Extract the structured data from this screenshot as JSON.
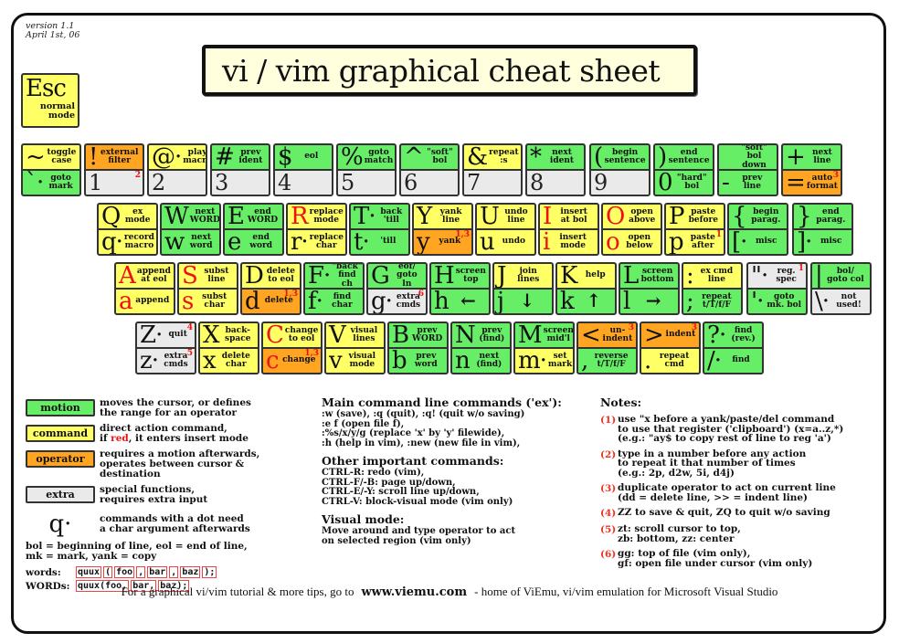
{
  "version": {
    "line1": "version 1.1",
    "line2": "April 1st, 06"
  },
  "title": "vi / vim graphical cheat sheet",
  "colors": {
    "motion": "#66ee66",
    "command": "#ffff66",
    "operator": "#ffa522",
    "extra": "#eaeaea",
    "red": "#ee1111"
  },
  "esc": {
    "glyph": "Esc",
    "desc": "normal\nmode",
    "type": "command"
  },
  "rows": [
    {
      "name": "number-row",
      "keys": [
        {
          "id": "tilde",
          "top": {
            "glyph": "~",
            "desc": "toggle\ncase",
            "type": "command"
          },
          "bottom": {
            "glyph": "`·",
            "desc": "goto\nmark",
            "type": "motion"
          }
        },
        {
          "id": "1",
          "top": {
            "glyph": "!",
            "desc": "external\nfilter",
            "type": "operator"
          },
          "bottom": {
            "glyph": "1",
            "desc": "",
            "type": "blank",
            "note": "2"
          }
        },
        {
          "id": "2",
          "top": {
            "glyph": "@·",
            "desc": "play\nmacro",
            "type": "command"
          },
          "bottom": {
            "glyph": "2",
            "desc": "",
            "type": "blank"
          }
        },
        {
          "id": "3",
          "top": {
            "glyph": "#",
            "desc": "prev\nident",
            "type": "motion"
          },
          "bottom": {
            "glyph": "3",
            "desc": "",
            "type": "blank"
          }
        },
        {
          "id": "4",
          "top": {
            "glyph": "$",
            "desc": "eol",
            "type": "motion"
          },
          "bottom": {
            "glyph": "4",
            "desc": "",
            "type": "blank"
          }
        },
        {
          "id": "5",
          "top": {
            "glyph": "%",
            "desc": "goto\nmatch",
            "type": "motion"
          },
          "bottom": {
            "glyph": "5",
            "desc": "",
            "type": "blank"
          }
        },
        {
          "id": "6",
          "top": {
            "glyph": "^",
            "desc": "\"soft\"\nbol",
            "type": "motion"
          },
          "bottom": {
            "glyph": "6",
            "desc": "",
            "type": "blank"
          }
        },
        {
          "id": "7",
          "top": {
            "glyph": "&",
            "desc": "repeat\n:s",
            "type": "command"
          },
          "bottom": {
            "glyph": "7",
            "desc": "",
            "type": "blank"
          }
        },
        {
          "id": "8",
          "top": {
            "glyph": "*",
            "desc": "next\nident",
            "type": "motion"
          },
          "bottom": {
            "glyph": "8",
            "desc": "",
            "type": "blank"
          }
        },
        {
          "id": "9",
          "top": {
            "glyph": "(",
            "desc": "begin\nsentence",
            "type": "motion"
          },
          "bottom": {
            "glyph": "9",
            "desc": "",
            "type": "blank"
          }
        },
        {
          "id": "0",
          "top": {
            "glyph": ")",
            "desc": "end\nsentence",
            "type": "motion"
          },
          "bottom": {
            "glyph": "0",
            "desc": "\"hard\"\nbol",
            "type": "motion"
          }
        },
        {
          "id": "minus",
          "top": {
            "glyph": "_",
            "desc": "\"soft\" bol\ndown",
            "type": "motion"
          },
          "bottom": {
            "glyph": "-",
            "desc": "prev\nline",
            "type": "motion"
          }
        },
        {
          "id": "plus",
          "top": {
            "glyph": "+",
            "desc": "next\nline",
            "type": "motion"
          },
          "bottom": {
            "glyph": "=",
            "desc": "auto\nformat",
            "type": "operator",
            "note": "3"
          }
        }
      ]
    },
    {
      "name": "qwerty-row",
      "keys": [
        {
          "id": "q",
          "top": {
            "glyph": "Q",
            "desc": "ex\nmode",
            "type": "command"
          },
          "bottom": {
            "glyph": "q·",
            "desc": "record\nmacro",
            "type": "command"
          }
        },
        {
          "id": "w",
          "top": {
            "glyph": "W",
            "desc": "next\nWORD",
            "type": "motion"
          },
          "bottom": {
            "glyph": "w",
            "desc": "next\nword",
            "type": "motion"
          }
        },
        {
          "id": "e",
          "top": {
            "glyph": "E",
            "desc": "end\nWORD",
            "type": "motion"
          },
          "bottom": {
            "glyph": "e",
            "desc": "end\nword",
            "type": "motion"
          }
        },
        {
          "id": "r",
          "top": {
            "glyph": "R",
            "desc": "replace\nmode",
            "type": "command",
            "red": true
          },
          "bottom": {
            "glyph": "r·",
            "desc": "replace\nchar",
            "type": "command"
          }
        },
        {
          "id": "t",
          "top": {
            "glyph": "T·",
            "desc": "back\n'till",
            "type": "motion"
          },
          "bottom": {
            "glyph": "t·",
            "desc": "'till",
            "type": "motion"
          }
        },
        {
          "id": "y",
          "top": {
            "glyph": "Y",
            "desc": "yank\nline",
            "type": "command"
          },
          "bottom": {
            "glyph": "y",
            "desc": "yank",
            "type": "operator",
            "note": "1,3"
          }
        },
        {
          "id": "u",
          "top": {
            "glyph": "U",
            "desc": "undo\nline",
            "type": "command"
          },
          "bottom": {
            "glyph": "u",
            "desc": "undo",
            "type": "command"
          }
        },
        {
          "id": "i",
          "top": {
            "glyph": "I",
            "desc": "insert\nat bol",
            "type": "command",
            "red": true
          },
          "bottom": {
            "glyph": "i",
            "desc": "insert\nmode",
            "type": "command",
            "red": true
          }
        },
        {
          "id": "o",
          "top": {
            "glyph": "O",
            "desc": "open\nabove",
            "type": "command",
            "red": true
          },
          "bottom": {
            "glyph": "o",
            "desc": "open\nbelow",
            "type": "command",
            "red": true
          }
        },
        {
          "id": "p",
          "top": {
            "glyph": "P",
            "desc": "paste\nbefore",
            "type": "command"
          },
          "bottom": {
            "glyph": "p",
            "desc": "paste\nafter",
            "type": "command",
            "note": "1"
          }
        },
        {
          "id": "lbracket",
          "top": {
            "glyph": "{",
            "desc": "begin\nparag.",
            "type": "motion"
          },
          "bottom": {
            "glyph": "[·",
            "desc": "misc",
            "type": "motion"
          }
        },
        {
          "id": "rbracket",
          "top": {
            "glyph": "}",
            "desc": "end\nparag.",
            "type": "motion"
          },
          "bottom": {
            "glyph": "]·",
            "desc": "misc",
            "type": "motion"
          }
        }
      ]
    },
    {
      "name": "home-row",
      "keys": [
        {
          "id": "a",
          "top": {
            "glyph": "A",
            "desc": "append\nat eol",
            "type": "command",
            "red": true
          },
          "bottom": {
            "glyph": "a",
            "desc": "append",
            "type": "command",
            "red": true
          }
        },
        {
          "id": "s",
          "top": {
            "glyph": "S",
            "desc": "subst\nline",
            "type": "command",
            "red": true
          },
          "bottom": {
            "glyph": "s",
            "desc": "subst\nchar",
            "type": "command",
            "red": true
          }
        },
        {
          "id": "d",
          "top": {
            "glyph": "D",
            "desc": "delete\nto eol",
            "type": "command"
          },
          "bottom": {
            "glyph": "d",
            "desc": "delete",
            "type": "operator",
            "note": "1,3"
          }
        },
        {
          "id": "f",
          "top": {
            "glyph": "F·",
            "desc": "\"back\"\nfind ch",
            "type": "motion"
          },
          "bottom": {
            "glyph": "f·",
            "desc": "find\nchar",
            "type": "motion"
          }
        },
        {
          "id": "g",
          "top": {
            "glyph": "G",
            "desc": "eof/\ngoto ln",
            "type": "motion"
          },
          "bottom": {
            "glyph": "g·",
            "desc": "extra\ncmds",
            "type": "extra",
            "note": "6"
          }
        },
        {
          "id": "h",
          "top": {
            "glyph": "H",
            "desc": "screen\ntop",
            "type": "motion"
          },
          "bottom": {
            "glyph": "h",
            "desc": "←",
            "type": "motion"
          }
        },
        {
          "id": "j",
          "top": {
            "glyph": "J",
            "desc": "join\nlines",
            "type": "command"
          },
          "bottom": {
            "glyph": "j",
            "desc": "↓",
            "type": "motion"
          }
        },
        {
          "id": "k",
          "top": {
            "glyph": "K",
            "desc": "help",
            "type": "command"
          },
          "bottom": {
            "glyph": "k",
            "desc": "↑",
            "type": "motion"
          }
        },
        {
          "id": "l",
          "top": {
            "glyph": "L",
            "desc": "screen\nbottom",
            "type": "motion"
          },
          "bottom": {
            "glyph": "l",
            "desc": "→",
            "type": "motion"
          }
        },
        {
          "id": "semicolon",
          "top": {
            "glyph": ":",
            "desc": "ex cmd\nline",
            "type": "command"
          },
          "bottom": {
            "glyph": ";",
            "desc": "repeat\nt/T/f/F",
            "type": "motion"
          }
        },
        {
          "id": "quote",
          "top": {
            "glyph": "\"·",
            "desc": "reg.\nspec",
            "type": "extra",
            "note": "1"
          },
          "bottom": {
            "glyph": "'·",
            "desc": "goto\nmk. bol",
            "type": "motion"
          }
        },
        {
          "id": "backslash",
          "top": {
            "glyph": "|",
            "desc": "bol/\ngoto col",
            "type": "motion"
          },
          "bottom": {
            "glyph": "\\·",
            "desc": "not\nused!",
            "type": "extra"
          }
        }
      ]
    },
    {
      "name": "bottom-row",
      "keys": [
        {
          "id": "z",
          "top": {
            "glyph": "Z·",
            "desc": "quit",
            "type": "extra",
            "note": "4"
          },
          "bottom": {
            "glyph": "z·",
            "desc": "extra\ncmds",
            "type": "extra",
            "note": "5"
          }
        },
        {
          "id": "x",
          "top": {
            "glyph": "X",
            "desc": "back-\nspace",
            "type": "command"
          },
          "bottom": {
            "glyph": "x",
            "desc": "delete\nchar",
            "type": "command"
          }
        },
        {
          "id": "c",
          "top": {
            "glyph": "C",
            "desc": "change\nto eol",
            "type": "command",
            "red": true
          },
          "bottom": {
            "glyph": "c",
            "desc": "change",
            "type": "operator",
            "red": true,
            "note": "1,3"
          }
        },
        {
          "id": "v",
          "top": {
            "glyph": "V",
            "desc": "visual\nlines",
            "type": "command"
          },
          "bottom": {
            "glyph": "v",
            "desc": "visual\nmode",
            "type": "command"
          }
        },
        {
          "id": "b",
          "top": {
            "glyph": "B",
            "desc": "prev\nWORD",
            "type": "motion"
          },
          "bottom": {
            "glyph": "b",
            "desc": "prev\nword",
            "type": "motion"
          }
        },
        {
          "id": "n",
          "top": {
            "glyph": "N",
            "desc": "prev\n(find)",
            "type": "motion"
          },
          "bottom": {
            "glyph": "n",
            "desc": "next\n(find)",
            "type": "motion"
          }
        },
        {
          "id": "m",
          "top": {
            "glyph": "M",
            "desc": "screen\nmid'l",
            "type": "motion"
          },
          "bottom": {
            "glyph": "m·",
            "desc": "set\nmark",
            "type": "command"
          }
        },
        {
          "id": "comma",
          "top": {
            "glyph": "<",
            "desc": "un-\nindent",
            "type": "operator",
            "note": "3"
          },
          "bottom": {
            "glyph": ",",
            "desc": "reverse\nt/T/f/F",
            "type": "motion"
          }
        },
        {
          "id": "period",
          "top": {
            "glyph": ">",
            "desc": "indent",
            "type": "operator",
            "note": "3"
          },
          "bottom": {
            "glyph": ".",
            "desc": "repeat\ncmd",
            "type": "command"
          }
        },
        {
          "id": "slash",
          "top": {
            "glyph": "?·",
            "desc": "find\n(rev.)",
            "type": "motion"
          },
          "bottom": {
            "glyph": "/·",
            "desc": "find",
            "type": "motion"
          }
        }
      ]
    }
  ],
  "legend": {
    "items": [
      {
        "label": "motion",
        "type": "motion",
        "text": "moves the cursor, or defines\nthe range for an operator"
      },
      {
        "label": "command",
        "type": "command",
        "text_pre": "direct action command,\nif ",
        "text_red": "red",
        "text_post": ", it enters insert mode"
      },
      {
        "label": "operator",
        "type": "operator",
        "text": "requires a motion afterwards,\noperates between cursor &\ndestination"
      },
      {
        "label": "extra",
        "type": "extra",
        "text": "special functions,\nrequires extra input"
      }
    ],
    "dot_glyph": "q·",
    "dot_text": "commands with a dot need\na char argument afterwards",
    "abbrev": "bol = beginning of line, eol = end of line,\nmk = mark, yank = copy",
    "words_label": "words:",
    "words_tokens": [
      "quux",
      "(",
      "foo",
      ",",
      "bar",
      ",",
      "baz",
      ");"
    ],
    "WORDs_label": "WORDs:",
    "WORDs_tokens": [
      "quux(foo,",
      "bar,",
      "baz);"
    ]
  },
  "ex": {
    "heading": "Main command line commands ('ex'):",
    "lines": [
      ":w (save), :q (quit), :q! (quit w/o saving)",
      ":e f (open file f),",
      ":%s/x/y/g (replace 'x' by 'y' filewide),",
      ":h (help in vim), :new (new file in vim),"
    ]
  },
  "other": {
    "heading": "Other important commands:",
    "lines": [
      "CTRL-R: redo (vim),",
      "CTRL-F/-B: page up/down,",
      "CTRL-E/-Y: scroll line up/down,",
      "CTRL-V: block-visual mode (vim only)"
    ]
  },
  "visual": {
    "heading": "Visual mode:",
    "lines": [
      "Move around and type operator to act",
      "on selected region (vim only)"
    ]
  },
  "notes": {
    "heading": "Notes:",
    "items": [
      {
        "num": "(1)",
        "text": "use \"x before a yank/paste/del command\nto use that register ('clipboard') (x=a..z,*)\n(e.g.: \"ay$ to copy rest of line to reg 'a')"
      },
      {
        "num": "(2)",
        "text": "type in a number before any action\nto repeat it that number of times\n(e.g.: 2p, d2w, 5i, d4j)"
      },
      {
        "num": "(3)",
        "text": "duplicate operator to act on current line\n(dd = delete line, >> = indent line)"
      },
      {
        "num": "(4)",
        "text": "ZZ to save & quit, ZQ to quit w/o saving"
      },
      {
        "num": "(5)",
        "text": "zt: scroll cursor to top,\nzb: bottom, zz: center"
      },
      {
        "num": "(6)",
        "text": "gg: top of file (vim only),\ngf: open file under cursor (vim only)"
      }
    ]
  },
  "footer": {
    "pre": "For a graphical vi/vim tutorial & more tips, go to",
    "link": "www.viemu.com",
    "post": "- home of ViEmu, vi/vim emulation for Microsoft Visual Studio"
  }
}
